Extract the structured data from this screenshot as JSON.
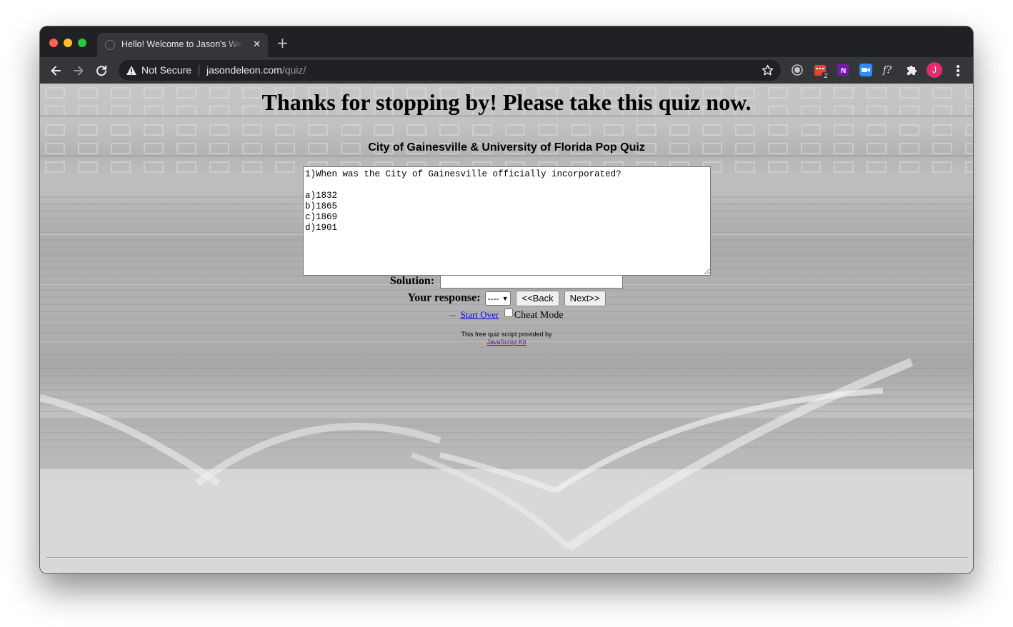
{
  "browser": {
    "tab": {
      "title": "Hello! Welcome to Jason's Website",
      "close_symbol": "✕"
    },
    "new_tab_symbol": "+",
    "omnibox": {
      "security_label": "Not Secure",
      "url_host": "jasondeleon.com",
      "url_path": "/quiz/"
    },
    "extensions": [
      {
        "name": "record-extension-icon",
        "color": "#c4c7c5"
      },
      {
        "name": "todoist-extension-icon",
        "color": "#e44332",
        "badge": "2"
      },
      {
        "name": "onenote-extension-icon",
        "color": "#7719aa",
        "text": "N"
      },
      {
        "name": "zoom-extension-icon",
        "color": "#2d8cff"
      },
      {
        "name": "fonts-extension-icon",
        "color": "#e8eaed",
        "text": "f?"
      },
      {
        "name": "puzzle-extension-icon",
        "color": "#e8eaed"
      }
    ],
    "profile": {
      "initial": "J",
      "color": "#e52b6f"
    }
  },
  "page": {
    "headline": "Thanks for stopping by! Please take this quiz now.",
    "quiz_title": "City of Gainesville & University of Florida Pop Quiz",
    "question_text": "1)When was the City of Gainesville officially incorporated?\n\na)1832\nb)1865\nc)1869\nd)1901",
    "solution_label": "Solution:",
    "solution_value": "",
    "response_label": "Your response:",
    "response_selected": "----",
    "back_button": "<<Back",
    "next_button": "Next>>",
    "start_over_link": "Start Over",
    "cheat_mode_label": "Cheat Mode",
    "credit_line": "This free quiz script provided by",
    "credit_link": "JavaScript Kit"
  }
}
